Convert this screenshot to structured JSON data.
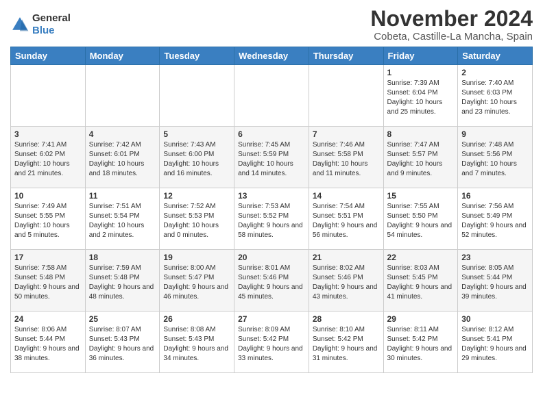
{
  "header": {
    "logo_line1": "General",
    "logo_line2": "Blue",
    "title": "November 2024",
    "subtitle": "Cobeta, Castille-La Mancha, Spain"
  },
  "weekdays": [
    "Sunday",
    "Monday",
    "Tuesday",
    "Wednesday",
    "Thursday",
    "Friday",
    "Saturday"
  ],
  "weeks": [
    [
      {
        "day": "",
        "info": ""
      },
      {
        "day": "",
        "info": ""
      },
      {
        "day": "",
        "info": ""
      },
      {
        "day": "",
        "info": ""
      },
      {
        "day": "",
        "info": ""
      },
      {
        "day": "1",
        "info": "Sunrise: 7:39 AM\nSunset: 6:04 PM\nDaylight: 10 hours and 25 minutes."
      },
      {
        "day": "2",
        "info": "Sunrise: 7:40 AM\nSunset: 6:03 PM\nDaylight: 10 hours and 23 minutes."
      }
    ],
    [
      {
        "day": "3",
        "info": "Sunrise: 7:41 AM\nSunset: 6:02 PM\nDaylight: 10 hours and 21 minutes."
      },
      {
        "day": "4",
        "info": "Sunrise: 7:42 AM\nSunset: 6:01 PM\nDaylight: 10 hours and 18 minutes."
      },
      {
        "day": "5",
        "info": "Sunrise: 7:43 AM\nSunset: 6:00 PM\nDaylight: 10 hours and 16 minutes."
      },
      {
        "day": "6",
        "info": "Sunrise: 7:45 AM\nSunset: 5:59 PM\nDaylight: 10 hours and 14 minutes."
      },
      {
        "day": "7",
        "info": "Sunrise: 7:46 AM\nSunset: 5:58 PM\nDaylight: 10 hours and 11 minutes."
      },
      {
        "day": "8",
        "info": "Sunrise: 7:47 AM\nSunset: 5:57 PM\nDaylight: 10 hours and 9 minutes."
      },
      {
        "day": "9",
        "info": "Sunrise: 7:48 AM\nSunset: 5:56 PM\nDaylight: 10 hours and 7 minutes."
      }
    ],
    [
      {
        "day": "10",
        "info": "Sunrise: 7:49 AM\nSunset: 5:55 PM\nDaylight: 10 hours and 5 minutes."
      },
      {
        "day": "11",
        "info": "Sunrise: 7:51 AM\nSunset: 5:54 PM\nDaylight: 10 hours and 2 minutes."
      },
      {
        "day": "12",
        "info": "Sunrise: 7:52 AM\nSunset: 5:53 PM\nDaylight: 10 hours and 0 minutes."
      },
      {
        "day": "13",
        "info": "Sunrise: 7:53 AM\nSunset: 5:52 PM\nDaylight: 9 hours and 58 minutes."
      },
      {
        "day": "14",
        "info": "Sunrise: 7:54 AM\nSunset: 5:51 PM\nDaylight: 9 hours and 56 minutes."
      },
      {
        "day": "15",
        "info": "Sunrise: 7:55 AM\nSunset: 5:50 PM\nDaylight: 9 hours and 54 minutes."
      },
      {
        "day": "16",
        "info": "Sunrise: 7:56 AM\nSunset: 5:49 PM\nDaylight: 9 hours and 52 minutes."
      }
    ],
    [
      {
        "day": "17",
        "info": "Sunrise: 7:58 AM\nSunset: 5:48 PM\nDaylight: 9 hours and 50 minutes."
      },
      {
        "day": "18",
        "info": "Sunrise: 7:59 AM\nSunset: 5:48 PM\nDaylight: 9 hours and 48 minutes."
      },
      {
        "day": "19",
        "info": "Sunrise: 8:00 AM\nSunset: 5:47 PM\nDaylight: 9 hours and 46 minutes."
      },
      {
        "day": "20",
        "info": "Sunrise: 8:01 AM\nSunset: 5:46 PM\nDaylight: 9 hours and 45 minutes."
      },
      {
        "day": "21",
        "info": "Sunrise: 8:02 AM\nSunset: 5:46 PM\nDaylight: 9 hours and 43 minutes."
      },
      {
        "day": "22",
        "info": "Sunrise: 8:03 AM\nSunset: 5:45 PM\nDaylight: 9 hours and 41 minutes."
      },
      {
        "day": "23",
        "info": "Sunrise: 8:05 AM\nSunset: 5:44 PM\nDaylight: 9 hours and 39 minutes."
      }
    ],
    [
      {
        "day": "24",
        "info": "Sunrise: 8:06 AM\nSunset: 5:44 PM\nDaylight: 9 hours and 38 minutes."
      },
      {
        "day": "25",
        "info": "Sunrise: 8:07 AM\nSunset: 5:43 PM\nDaylight: 9 hours and 36 minutes."
      },
      {
        "day": "26",
        "info": "Sunrise: 8:08 AM\nSunset: 5:43 PM\nDaylight: 9 hours and 34 minutes."
      },
      {
        "day": "27",
        "info": "Sunrise: 8:09 AM\nSunset: 5:42 PM\nDaylight: 9 hours and 33 minutes."
      },
      {
        "day": "28",
        "info": "Sunrise: 8:10 AM\nSunset: 5:42 PM\nDaylight: 9 hours and 31 minutes."
      },
      {
        "day": "29",
        "info": "Sunrise: 8:11 AM\nSunset: 5:42 PM\nDaylight: 9 hours and 30 minutes."
      },
      {
        "day": "30",
        "info": "Sunrise: 8:12 AM\nSunset: 5:41 PM\nDaylight: 9 hours and 29 minutes."
      }
    ]
  ]
}
